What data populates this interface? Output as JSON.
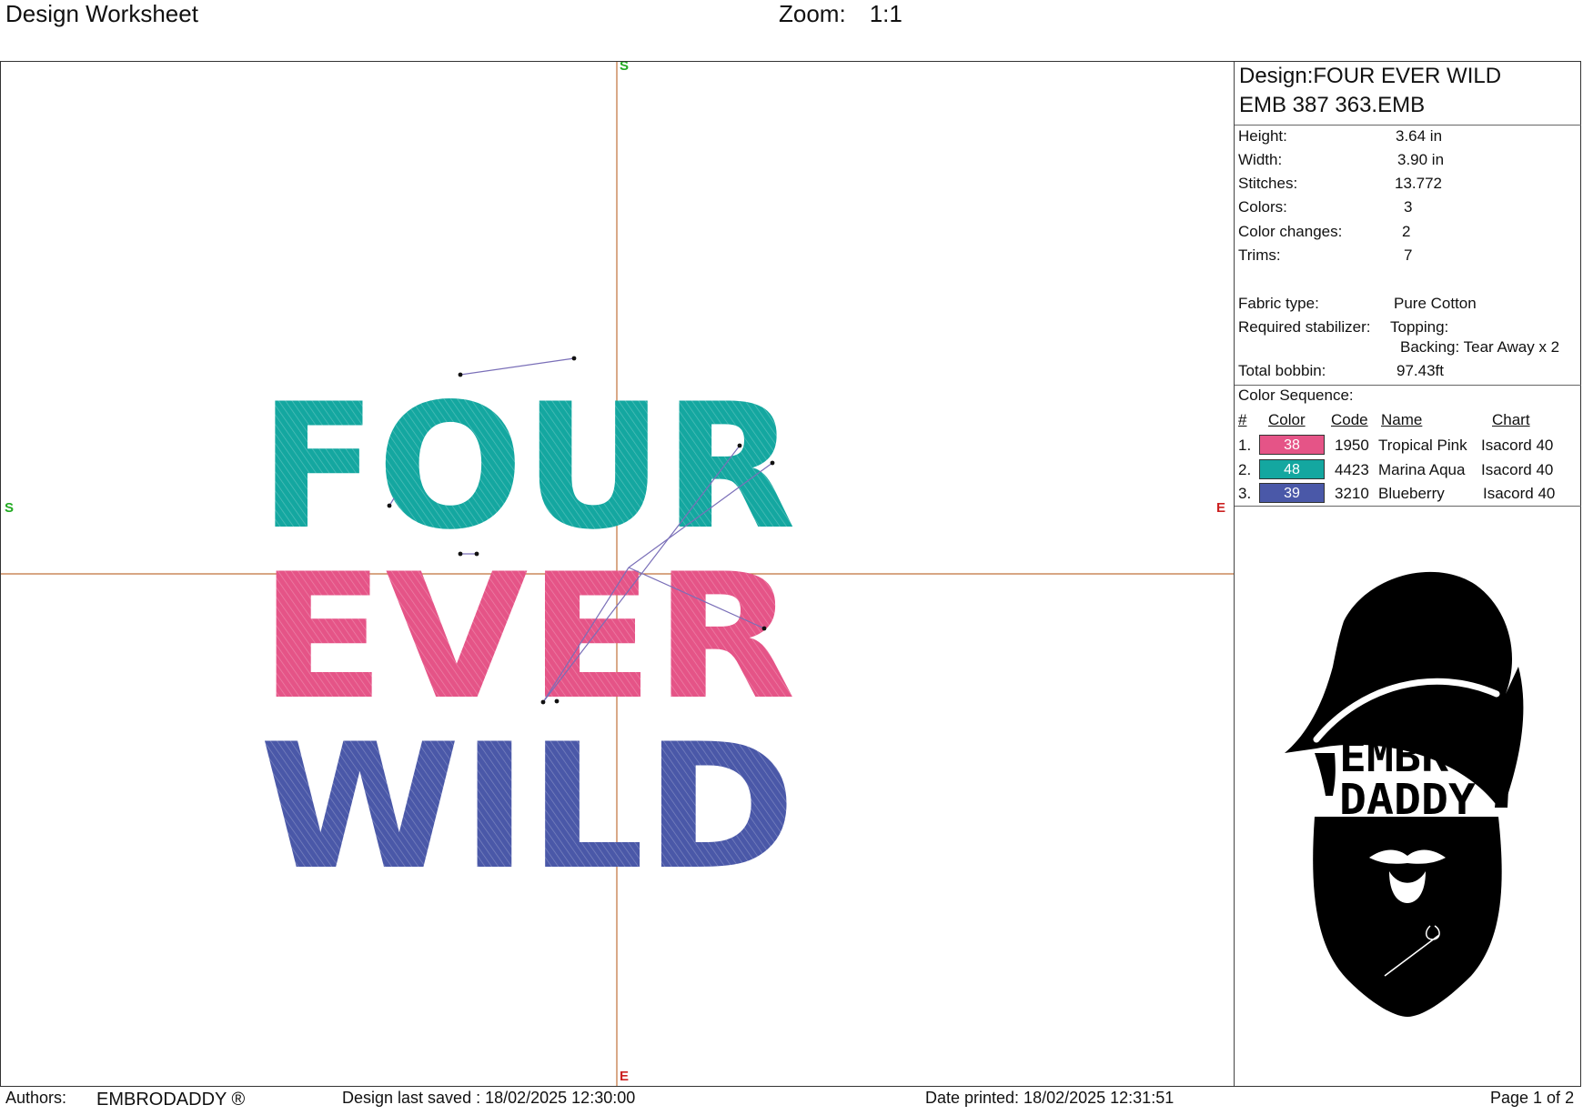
{
  "header": {
    "title": "Design Worksheet",
    "zoom_label": "Zoom:",
    "zoom_value": "1:1"
  },
  "canvas": {
    "axis_labels": {
      "top": "S",
      "left": "S",
      "right": "E",
      "bottom": "E"
    },
    "colors": {
      "axis": "#c0703a",
      "start": "#22aa22",
      "end": "#cc2222",
      "jump": "#7a6fb8"
    },
    "design_words": [
      "FOUR",
      "EVER",
      "WILD"
    ]
  },
  "info": {
    "design_line": "Design:FOUR EVER WILD",
    "file_line": "EMB 387 363.EMB",
    "stats": [
      {
        "label": "Height:",
        "value": "3.64 in"
      },
      {
        "label": "Width:",
        "value": "3.90 in"
      },
      {
        "label": "Stitches:",
        "value": "13.772"
      },
      {
        "label": "Colors:",
        "value": "3"
      },
      {
        "label": "Color changes:",
        "value": "2"
      },
      {
        "label": "Trims:",
        "value": "7"
      }
    ],
    "fabric": {
      "label": "Fabric type:",
      "value": "Pure Cotton"
    },
    "stabilizer": {
      "label": "Required stabilizer:",
      "topping": "Topping:",
      "backing": "Backing: Tear Away x 2"
    },
    "bobbin": {
      "label": "Total bobbin:",
      "value": "97.43ft"
    },
    "color_sequence": {
      "title": "Color Sequence:",
      "headers": [
        "#",
        "Color",
        "Code",
        "Name",
        "Chart"
      ],
      "rows": [
        {
          "num": "1.",
          "color_num": "38",
          "hex": "#e55487",
          "code": "1950",
          "name": "Tropical Pink",
          "chart": "Isacord 40"
        },
        {
          "num": "2.",
          "color_num": "48",
          "hex": "#14a7a0",
          "code": "4423",
          "name": "Marina Aqua",
          "chart": "Isacord 40"
        },
        {
          "num": "3.",
          "color_num": "39",
          "hex": "#4a58a8",
          "code": "3210",
          "name": "Blueberry",
          "chart": "Isacord 40"
        }
      ]
    },
    "logo": {
      "line1": "EMBRO",
      "line2": "DADDY"
    }
  },
  "footer": {
    "authors_label": "Authors:",
    "authors_value": "EMBRODADDY ®",
    "saved": "Design last saved : 18/02/2025 12:30:00",
    "printed": "Date printed: 18/02/2025 12:31:51",
    "page": "Page 1 of 2"
  }
}
